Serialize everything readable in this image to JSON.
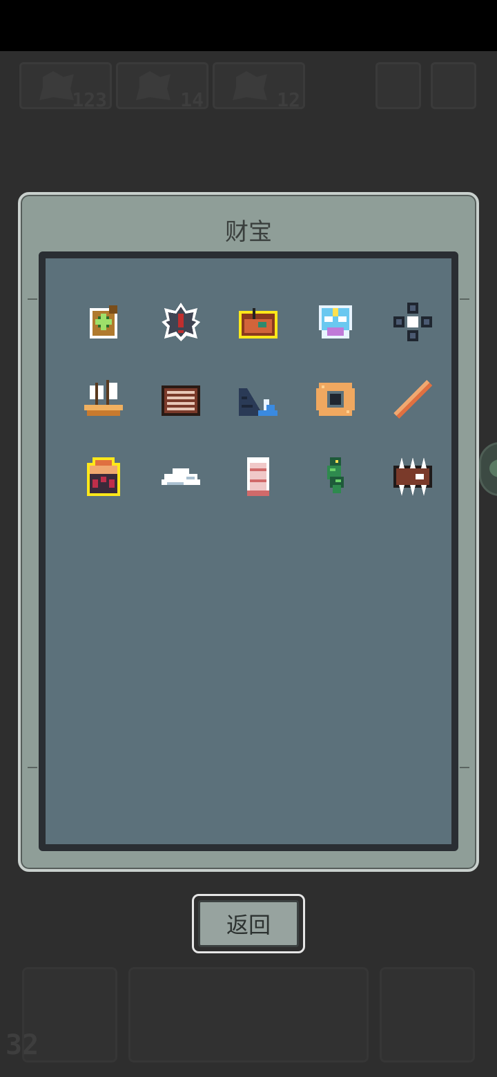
{
  "dialog": {
    "title": "财宝"
  },
  "return_button": {
    "label": "返回"
  },
  "background_hud": {
    "counts": [
      "123",
      "14",
      "12"
    ],
    "bottom_number": "32"
  },
  "treasures": [
    {
      "name": "compass-bag-icon"
    },
    {
      "name": "gear-gem-icon"
    },
    {
      "name": "chest-sign-icon",
      "highlighted": true
    },
    {
      "name": "mask-icon"
    },
    {
      "name": "flower-icon"
    },
    {
      "name": "ship-icon"
    },
    {
      "name": "abacus-icon"
    },
    {
      "name": "wave-wall-icon"
    },
    {
      "name": "ring-frame-icon"
    },
    {
      "name": "rod-icon"
    },
    {
      "name": "altar-icon",
      "highlighted": true
    },
    {
      "name": "cloud-icon"
    },
    {
      "name": "scroll-icon"
    },
    {
      "name": "seahorse-icon"
    },
    {
      "name": "spike-trap-icon"
    }
  ]
}
